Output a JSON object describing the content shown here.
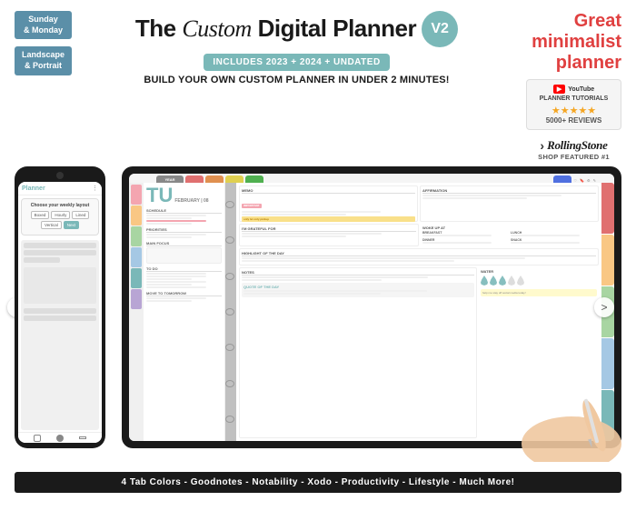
{
  "badges": {
    "sunday_monday": "Sunday\n& Monday",
    "landscape": "Landscape\n& Portrait",
    "v2": "V2"
  },
  "title": {
    "prefix": "The ",
    "custom": "Custom",
    "suffix": " Digital Planner",
    "includes": "INCLUDES 2023 + 2024 + UNDATED",
    "build": "BUILD YOUR OWN CUSTOM PLANNER IN UNDER 2 MINUTES!"
  },
  "sidebar_right": {
    "great": "Great\nminimalist\nplanner",
    "youtube_icon": "▶",
    "youtube_label": "YouTube",
    "planner_tutorials": "PLANNER TUTORIALS",
    "stars": "★★★★★",
    "reviews": "5000+ REVIEWS",
    "rolling_stone": "RollingStone",
    "shop_featured": "SHOP FEATURED #1"
  },
  "planner": {
    "date_big": "TU",
    "month_day": "FEBRUARY | 08",
    "sections": {
      "schedule": "SCHEDULE",
      "priorities": "PRIORITIES",
      "main_focus": "MAIN FOCUS",
      "to_do": "TO DO",
      "move_to_tomorrow": "MOVE TO TOMORROW",
      "memo": "MEMO",
      "affirmation": "AFFIRMATION",
      "grateful": "I'M GRATEFUL FOR",
      "woke_up": "WOKE UP AT",
      "highlight": "HIGHLIGHT OF THE DAY",
      "notes": "NOTES",
      "quote": "QUOTE OF THE DAY",
      "water": "WATER"
    }
  },
  "phone": {
    "choose_layout": "Choose your weekly layout",
    "buttons": [
      "Boxed",
      "Hourly",
      "Lined",
      "Vertical",
      "Next"
    ]
  },
  "bottom_bar": {
    "text": "4 Tab Colors - Goodnotes - Notability - Xodo - Productivity - Lifestyle - Much More!"
  },
  "nav": {
    "left": "<",
    "right": ">"
  }
}
